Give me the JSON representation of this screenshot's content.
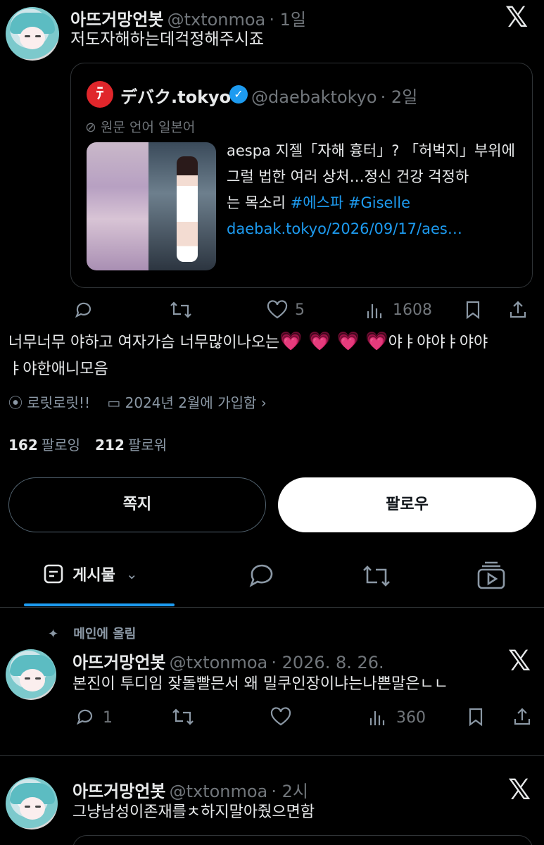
{
  "tweet1": {
    "name": "아뜨거망언봇",
    "handle": "@txtonmoa",
    "time": "· 1일",
    "text": "저도자해하는데걱정해주시죠"
  },
  "quote": {
    "logo": "ﾃ",
    "name": "デバク.tokyo",
    "handle": "@daebaktokyo",
    "time": "· 2일",
    "translate_label": "원문 언어 일본어",
    "text_line1": "aespa 지젤「자해 흉터」? 「허벅지」부위에",
    "text_line2": "그럴 법한 여러 상처…정신 건강 걱정하",
    "text_line3_prefix": "는 목소리 ",
    "hashtag1": "#에스파",
    "hashtag2": "#Giselle",
    "link": "daebak.tokyo/2026/09/17/aes…"
  },
  "tweet1_actions": {
    "likes": "5",
    "views": "1608"
  },
  "bio": {
    "line1": "너무너무 야하고 여자가슴 너무많이나오는",
    "hearts": "💗 💗 💗 💗",
    "line1_suffix": "야ㅑ야야ㅑ야야",
    "line2": "ㅑ야한애니모음"
  },
  "profile_meta": {
    "location": "로릿로릿!!",
    "joined": "2024년 2월에 가입함"
  },
  "stats": {
    "following_num": "162",
    "following_lbl": "팔로잉",
    "followers_num": "212",
    "followers_lbl": "팔로워"
  },
  "buttons": {
    "message": "쪽지",
    "follow": "팔로우"
  },
  "tabs": {
    "posts": "게시물"
  },
  "pinned": {
    "label": "메인에 올림"
  },
  "tweet2": {
    "name": "아뜨거망언봇",
    "handle": "@txtonmoa",
    "time": "· 2026. 8. 26.",
    "text": "본진이 투디임 잦돌빨믄서 왜 밀쿠인장이냐는나쁜말은ㄴㄴ",
    "replies": "1",
    "views": "360"
  },
  "tweet3": {
    "name": "아뜨거망언봇",
    "handle": "@txtonmoa",
    "time": "· 2시",
    "text": "그냥남성이존재를ㅊ하지말아줬으면함"
  },
  "colors": {
    "accent": "#1d9bf0",
    "heart": "#e63fbf",
    "muted": "#71767b"
  }
}
